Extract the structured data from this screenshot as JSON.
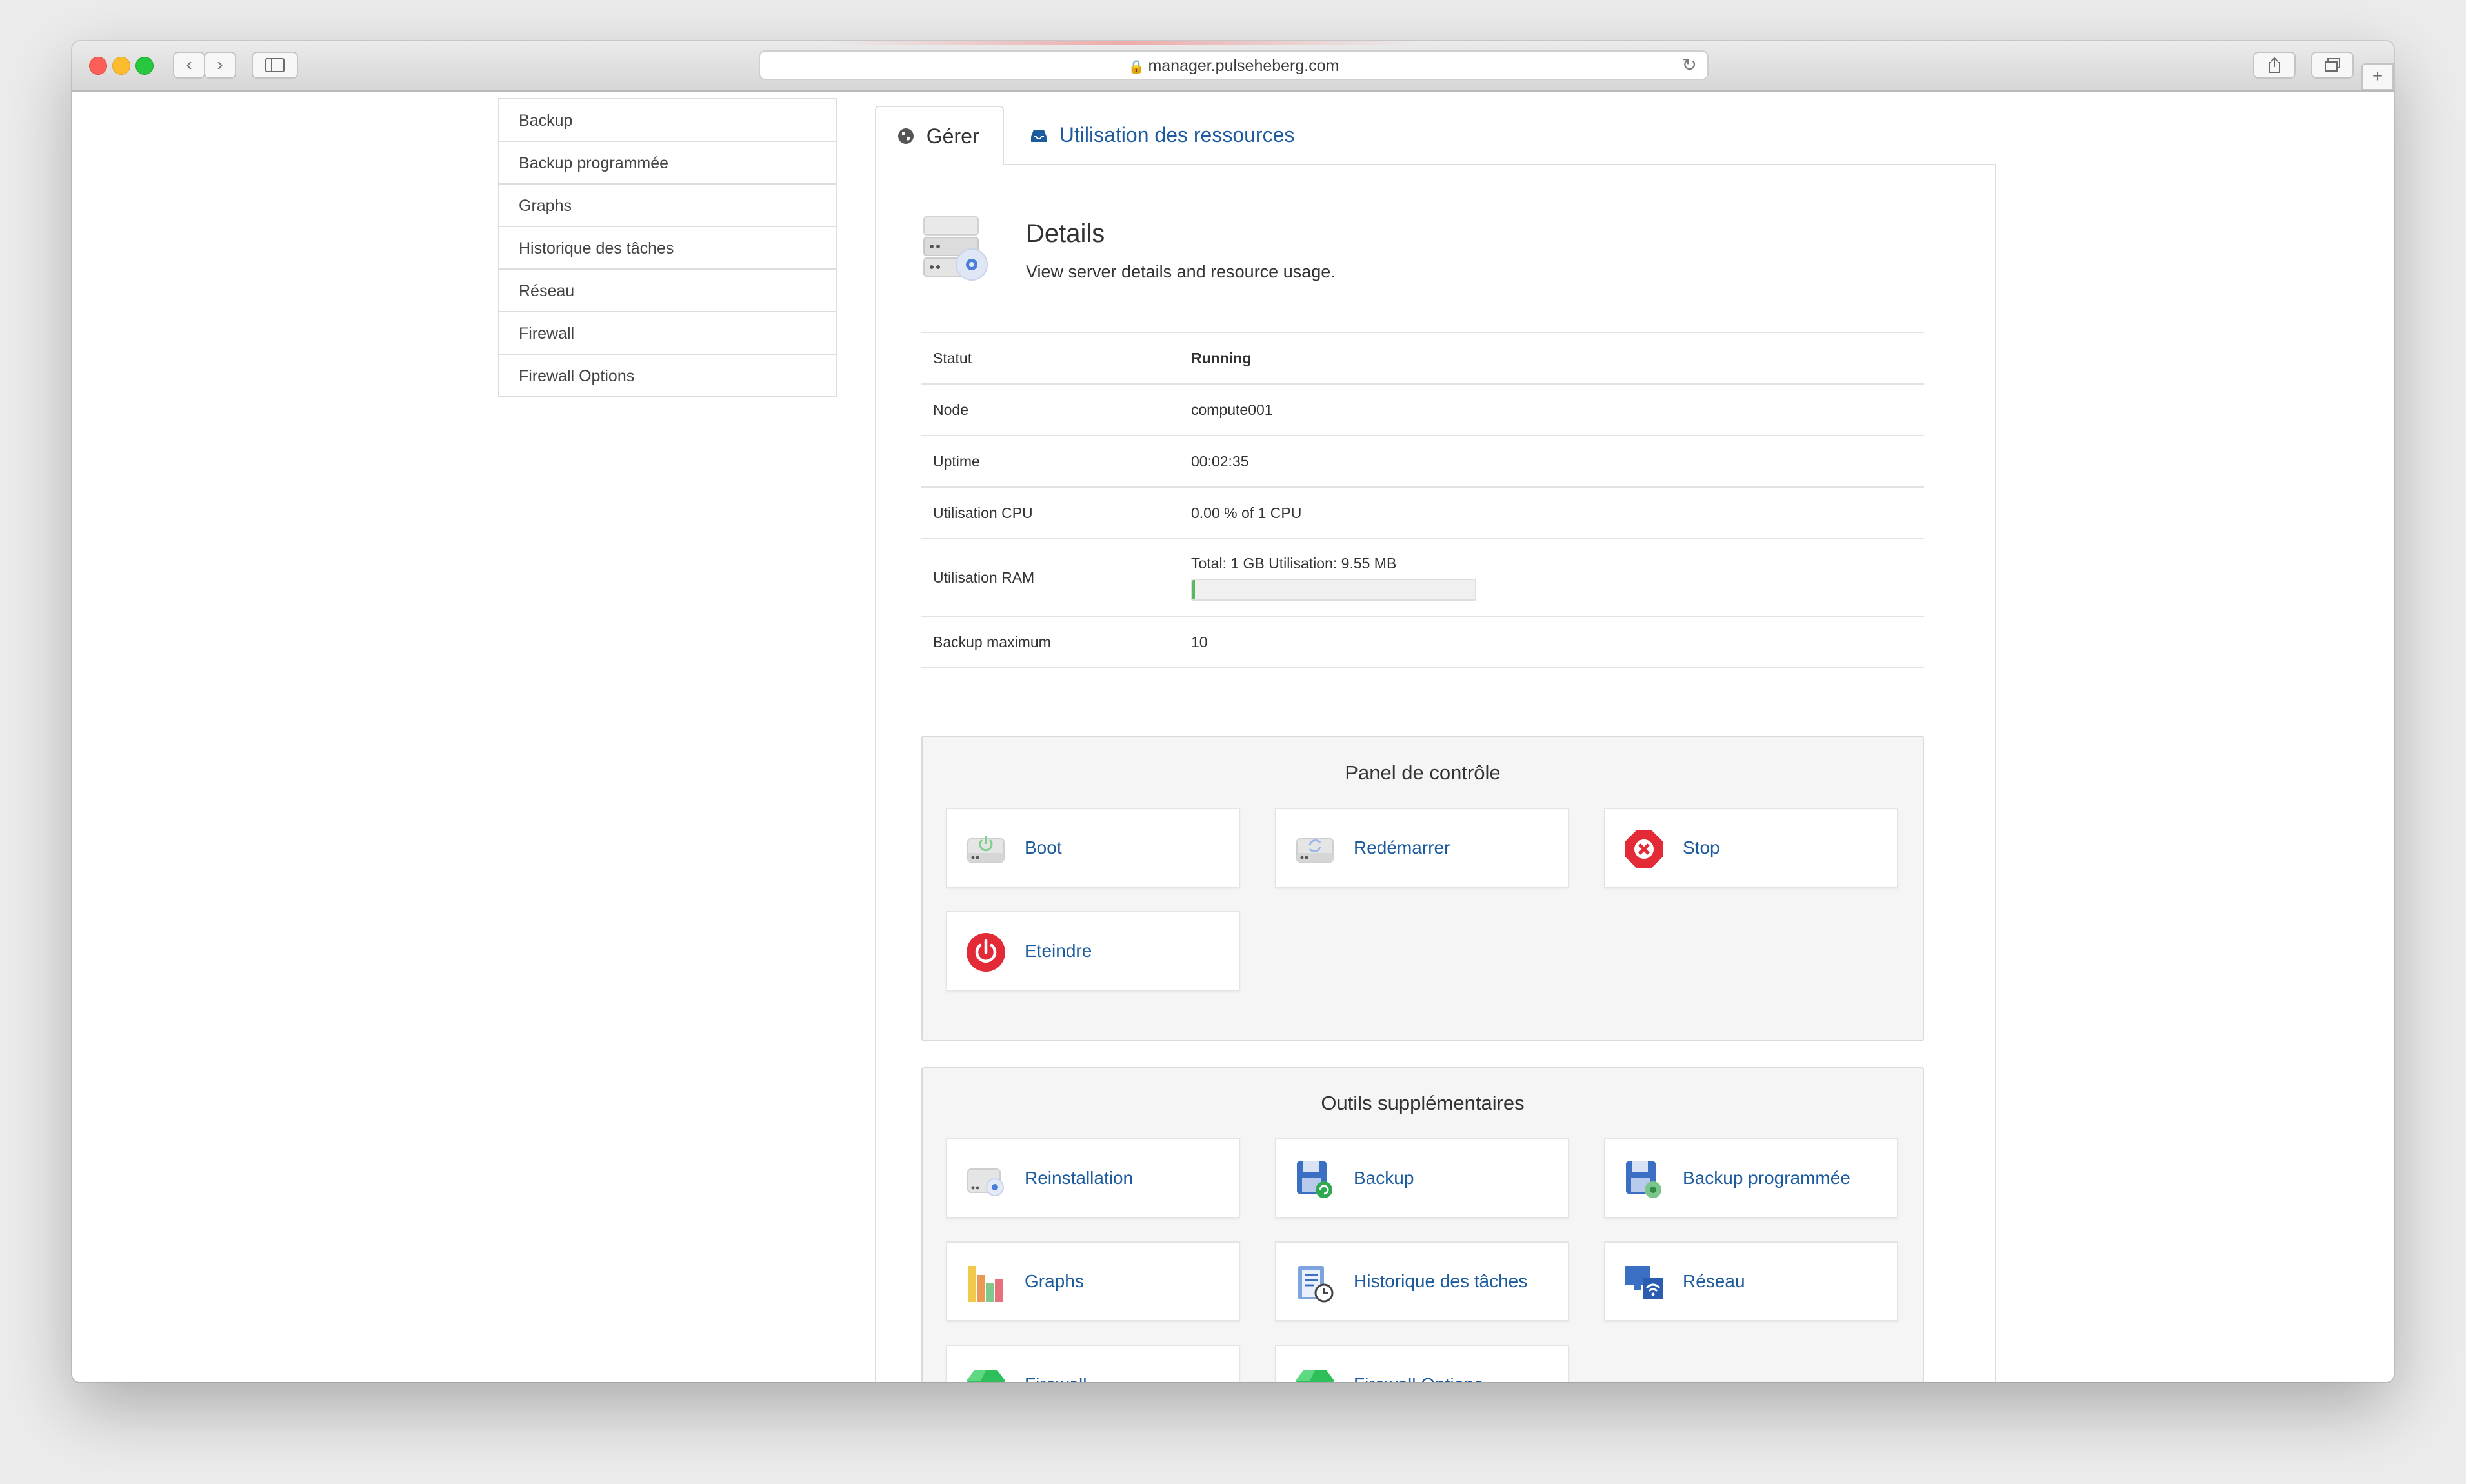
{
  "browser": {
    "url": "manager.pulseheberg.com"
  },
  "sidebar": {
    "items": [
      {
        "label": "Backup"
      },
      {
        "label": "Backup programmée"
      },
      {
        "label": "Graphs"
      },
      {
        "label": "Historique des tâches"
      },
      {
        "label": "Réseau"
      },
      {
        "label": "Firewall"
      },
      {
        "label": "Firewall Options"
      }
    ]
  },
  "tabs": [
    {
      "label": "Gérer",
      "icon": "globe-icon"
    },
    {
      "label": "Utilisation des ressources",
      "icon": "inbox-icon"
    }
  ],
  "details": {
    "title": "Details",
    "subtitle": "View server details and resource usage.",
    "rows": {
      "statut": {
        "label": "Statut",
        "value": "Running"
      },
      "node": {
        "label": "Node",
        "value": "compute001"
      },
      "uptime": {
        "label": "Uptime",
        "value": "00:02:35"
      },
      "cpu": {
        "label": "Utilisation CPU",
        "value": "0.00 % of 1 CPU"
      },
      "ram": {
        "label": "Utilisation RAM",
        "value": "Total: 1 GB Utilisation: 9.55 MB",
        "usage_percent": 0.9
      },
      "backup_max": {
        "label": "Backup maximum",
        "value": "10"
      }
    },
    "colors": {
      "running": "#2d8a22",
      "accent": "#1d5b9f"
    }
  },
  "control_panel": {
    "title": "Panel de contrôle",
    "buttons": [
      {
        "label": "Boot",
        "icon": "server-power-icon"
      },
      {
        "label": "Redémarrer",
        "icon": "server-restart-icon"
      },
      {
        "label": "Stop",
        "icon": "stop-icon"
      },
      {
        "label": "Eteindre",
        "icon": "power-icon"
      }
    ]
  },
  "tools": {
    "title": "Outils supplémentaires",
    "buttons": [
      {
        "label": "Reinstallation",
        "icon": "reinstall-icon"
      },
      {
        "label": "Backup",
        "icon": "backup-icon"
      },
      {
        "label": "Backup programmée",
        "icon": "scheduled-backup-icon"
      },
      {
        "label": "Graphs",
        "icon": "graphs-icon"
      },
      {
        "label": "Historique des tâches",
        "icon": "task-history-icon"
      },
      {
        "label": "Réseau",
        "icon": "network-icon"
      },
      {
        "label": "Firewall",
        "icon": "firewall-icon"
      },
      {
        "label": "Firewall Options",
        "icon": "firewall-options-icon"
      }
    ]
  }
}
